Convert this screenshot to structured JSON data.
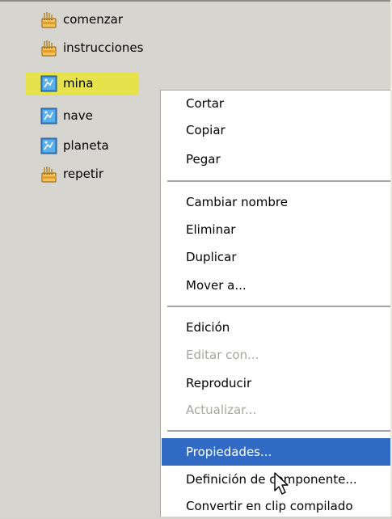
{
  "tree": {
    "items": [
      {
        "label": "comenzar",
        "icon": "hand-folder-icon"
      },
      {
        "label": "instrucciones",
        "icon": "hand-folder-icon"
      },
      {
        "label": "mina",
        "icon": "movieclip-icon",
        "selected": true
      },
      {
        "label": "nave",
        "icon": "movieclip-icon"
      },
      {
        "label": "planeta",
        "icon": "movieclip-icon"
      },
      {
        "label": "repetir",
        "icon": "hand-folder-icon"
      }
    ]
  },
  "context_menu": {
    "items": [
      {
        "label": "Cortar"
      },
      {
        "label": "Copiar"
      },
      {
        "label": "Pegar"
      },
      {
        "label": "Cambiar nombre"
      },
      {
        "label": "Eliminar"
      },
      {
        "label": "Duplicar"
      },
      {
        "label": "Mover a..."
      },
      {
        "label": "Edición"
      },
      {
        "label": "Editar con...",
        "disabled": true
      },
      {
        "label": "Reproducir"
      },
      {
        "label": "Actualizar...",
        "disabled": true
      },
      {
        "label": "Propiedades...",
        "highlighted": true
      },
      {
        "label": "Definición de componente..."
      },
      {
        "label": "Convertir en clip compilado"
      }
    ]
  },
  "colors": {
    "panel_bg": "#d7d5d0",
    "selection": "#e5e24b",
    "menu_highlight": "#316ac5",
    "disabled_text": "#a7a6a1"
  }
}
